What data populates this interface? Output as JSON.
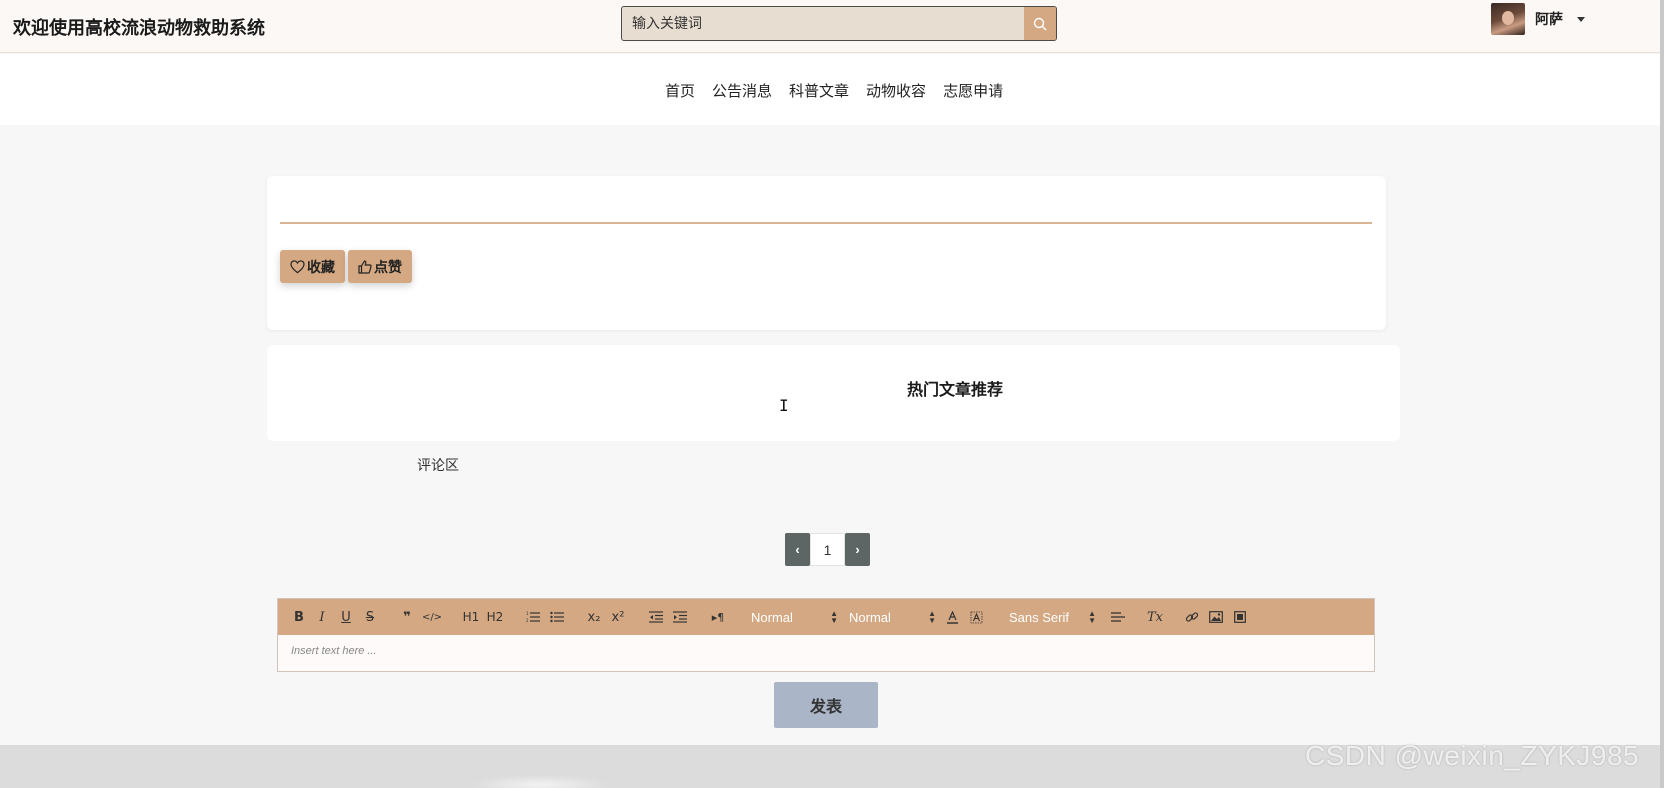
{
  "header": {
    "site_title": "欢迎使用高校流浪动物救助系统",
    "search_placeholder": "输入关键词",
    "username": "阿萨"
  },
  "nav": {
    "items": [
      "首页",
      "公告消息",
      "科普文章",
      "动物收容",
      "志愿申请"
    ]
  },
  "article": {
    "favorite_label": "收藏",
    "like_label": "点赞"
  },
  "hot": {
    "title": "热门文章推荐"
  },
  "comments": {
    "label": "评论区"
  },
  "pagination": {
    "prev": "‹",
    "current_page": "1",
    "next": "›"
  },
  "editor": {
    "toolbar": {
      "bold": "B",
      "italic": "I",
      "underline": "U",
      "strike": "S",
      "blockquote": "❞",
      "code": "</>",
      "h1": "H1",
      "h2": "H2",
      "subscript": "x₂",
      "superscript": "x²",
      "direction": "▸¶",
      "size_select": "Normal",
      "header_select": "Normal",
      "font_select": "Sans Serif",
      "clean": "Tx"
    },
    "placeholder": "Insert text here ..."
  },
  "submit_label": "发表",
  "watermark": "CSDN @weixin_ZYKJ985",
  "colors": {
    "accent": "#d4a882",
    "pager_dark": "#5d6664",
    "submit_bg": "#aab5c8"
  }
}
